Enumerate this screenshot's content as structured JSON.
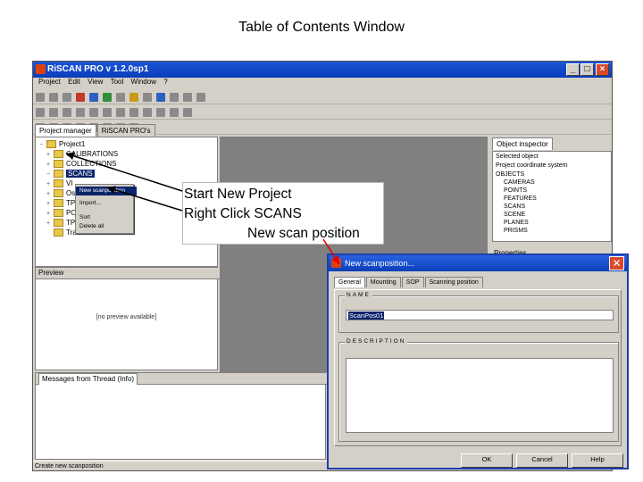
{
  "slide": {
    "title": "Table of Contents Window"
  },
  "app": {
    "title": "RiSCAN PRO v 1.2.0sp1",
    "menu": [
      "Project",
      "Edit",
      "View",
      "Tool",
      "Window",
      "?"
    ],
    "left_tabs": [
      "Project manager",
      "RiSCAN PRO's"
    ],
    "tree": [
      {
        "label": "Project1",
        "selected": false
      },
      {
        "label": "CALIBRATIONS",
        "selected": false
      },
      {
        "label": "COLLECTIONS",
        "selected": false
      },
      {
        "label": "SCANS",
        "selected": true
      },
      {
        "label": "VI",
        "selected": false
      },
      {
        "label": "Ost",
        "selected": false
      },
      {
        "label": "TPL",
        "selected": false
      },
      {
        "label": "PO",
        "selected": false
      },
      {
        "label": "TPL",
        "selected": false
      },
      {
        "label": "Trash",
        "selected": false
      }
    ],
    "context_menu": [
      "New scanposition",
      "Import...",
      "Sort",
      "Delete all"
    ],
    "preview": {
      "header": "Preview",
      "placeholder": "[no preview available]"
    },
    "right_tabs": [
      "Object inspector"
    ],
    "right_items": [
      "Selected object",
      "Project coordinate system",
      "OBJECTS",
      "CAMERAS",
      "POINTS",
      "FEATURES",
      "SCANS",
      "SCENE",
      "PLANES",
      "PRISMS"
    ],
    "properties_label": "Properties",
    "message_tab": "Messages from Thread (Info)",
    "status_text": "Create new scanposition"
  },
  "annotation": {
    "lines": [
      "Start New Project",
      "Right Click SCANS",
      "New scan position"
    ]
  },
  "dialog": {
    "title": "New scanposition...",
    "tabs": [
      "General",
      "Mounting",
      "SOP",
      "Scanning position"
    ],
    "name_label": "NAME",
    "name_value": "ScanPos01",
    "desc_label": "DESCRIPTION",
    "buttons": {
      "ok": "OK",
      "cancel": "Cancel",
      "help": "Help"
    }
  }
}
